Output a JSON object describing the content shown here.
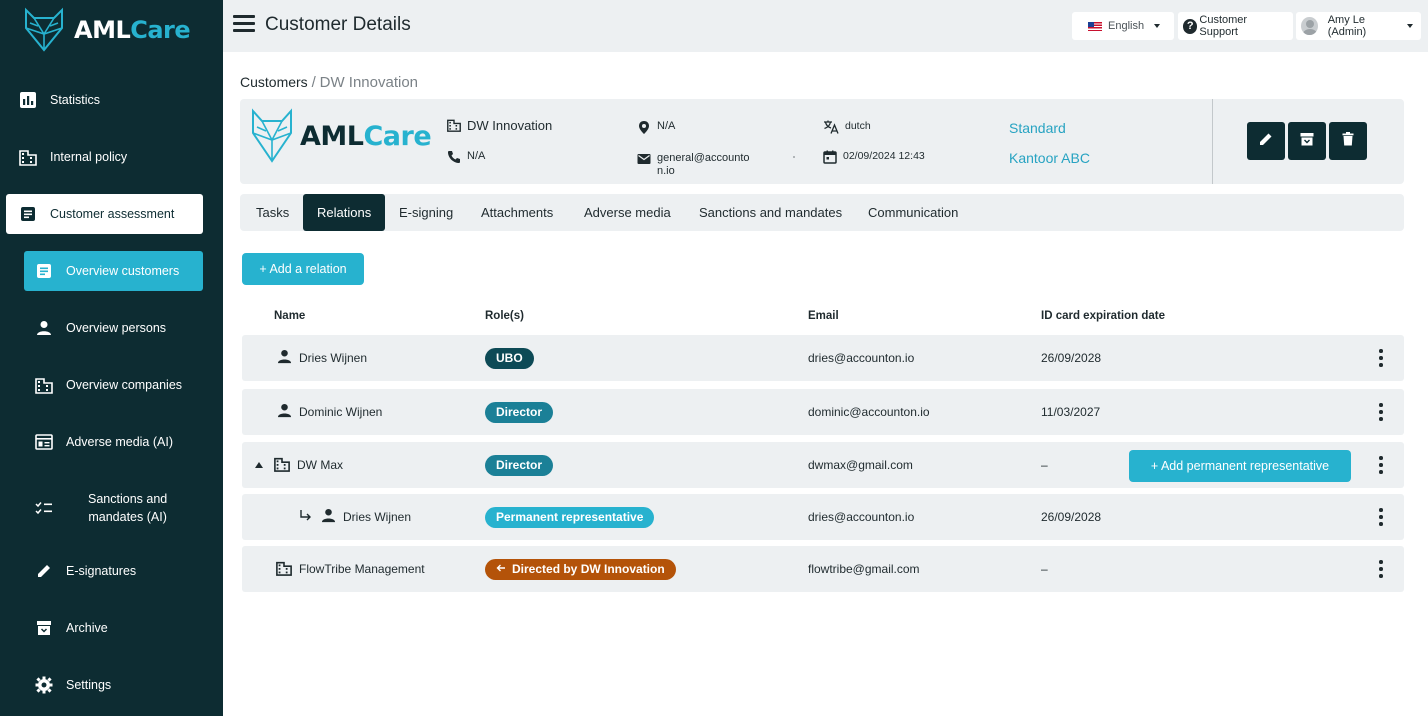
{
  "app": {
    "brand_aml": "AML",
    "brand_care": "Care"
  },
  "sidebar": {
    "items": [
      {
        "label": "Statistics",
        "icon": "bar-chart-icon"
      },
      {
        "label": "Internal policy",
        "icon": "building-icon"
      },
      {
        "label": "Customer assessment",
        "icon": "document-icon"
      },
      {
        "label": "Overview customers",
        "icon": "document-icon"
      },
      {
        "label": "Overview persons",
        "icon": "person-icon"
      },
      {
        "label": "Overview companies",
        "icon": "building-icon"
      },
      {
        "label": "Adverse media (AI)",
        "icon": "newspaper-icon"
      },
      {
        "label": "Sanctions and\nmandates (AI)",
        "icon": "checklist-icon"
      },
      {
        "label": "E-signatures",
        "icon": "pencil-icon"
      },
      {
        "label": "Archive",
        "icon": "archive-icon"
      },
      {
        "label": "Settings",
        "icon": "gear-icon"
      }
    ]
  },
  "topbar": {
    "title": "Customer Details",
    "language": "English",
    "support": "Customer Support",
    "user": "Amy Le (Admin)"
  },
  "breadcrumb": {
    "root": "Customers",
    "separator": "/",
    "current": "DW Innovation"
  },
  "customer": {
    "name": "DW Innovation",
    "phone": "N/A",
    "location": "N/A",
    "email": "general@accounto\nn.io",
    "language": "dutch",
    "date": "02/09/2024 12:43",
    "plan": "Standard",
    "office": "Kantoor ABC"
  },
  "tabs": [
    "Tasks",
    "Relations",
    "E-signing",
    "Attachments",
    "Adverse media",
    "Sanctions and mandates",
    "Communication"
  ],
  "active_tab": "Relations",
  "actions": {
    "add_relation": "+ Add a relation",
    "add_permanent_rep": "+ Add permanent representative"
  },
  "table": {
    "headers": [
      "Name",
      "Role(s)",
      "Email",
      "ID card expiration date"
    ],
    "rows": [
      {
        "name": "Dries Wijnen",
        "type": "person",
        "role": "UBO",
        "role_color": "#0d4a56",
        "email": "dries@accounton.io",
        "expiry": "26/09/2028"
      },
      {
        "name": "Dominic Wijnen",
        "type": "person",
        "role": "Director",
        "role_color": "#1b8097",
        "email": "dominic@accounton.io",
        "expiry": "11/03/2027"
      },
      {
        "name": "DW Max",
        "type": "company",
        "role": "Director",
        "role_color": "#1b8097",
        "email": "dwmax@gmail.com",
        "expiry": "–"
      },
      {
        "name": "Dries Wijnen",
        "type": "person",
        "role": "Permanent representative",
        "role_color": "#27b2cf",
        "email": "dries@accounton.io",
        "expiry": "26/09/2028"
      },
      {
        "name": "FlowTribe Management",
        "type": "company",
        "role": "Directed by DW Innovation",
        "role_color": "#b45309",
        "email": "flowtribe@gmail.com",
        "expiry": "–"
      }
    ]
  }
}
